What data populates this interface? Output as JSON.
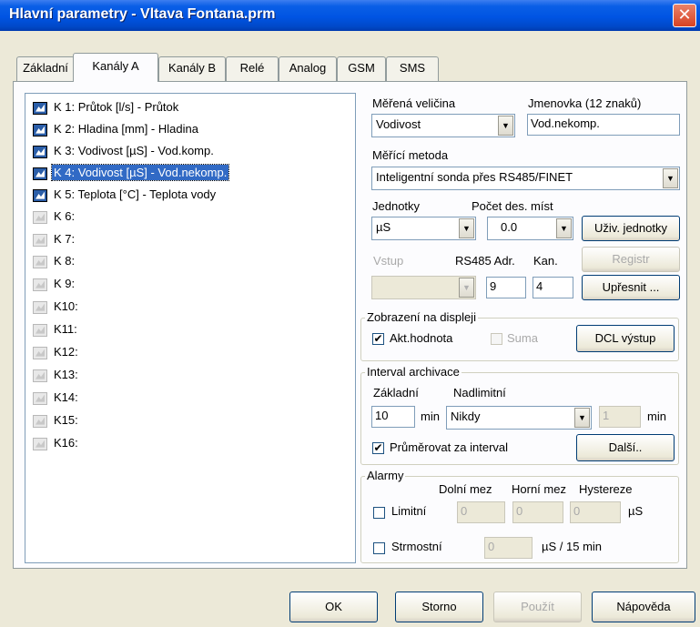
{
  "window": {
    "title": "Hlavní parametry - Vltava Fontana.prm",
    "close_glyph": "✕"
  },
  "tabs": [
    {
      "label": "Základní"
    },
    {
      "label": "Kanály A"
    },
    {
      "label": "Kanály B"
    },
    {
      "label": "Relé"
    },
    {
      "label": "Analog"
    },
    {
      "label": "GSM"
    },
    {
      "label": "SMS"
    }
  ],
  "channels": [
    {
      "label": "K 1: Průtok [l/s] - Průtok"
    },
    {
      "label": "K 2: Hladina [mm] - Hladina"
    },
    {
      "label": "K 3: Vodivost [µS] - Vod.komp."
    },
    {
      "label": "K 4: Vodivost [µS] - Vod.nekomp."
    },
    {
      "label": "K 5: Teplota [°C] - Teplota vody"
    },
    {
      "label": "K 6:"
    },
    {
      "label": "K 7:"
    },
    {
      "label": "K 8:"
    },
    {
      "label": "K 9:"
    },
    {
      "label": "K10:"
    },
    {
      "label": "K11:"
    },
    {
      "label": "K12:"
    },
    {
      "label": "K13:"
    },
    {
      "label": "K14:"
    },
    {
      "label": "K15:"
    },
    {
      "label": "K16:"
    }
  ],
  "measured": {
    "label": "Měřená veličina",
    "value": "Vodivost"
  },
  "nameplate": {
    "label": "Jmenovka  (12 znaků)",
    "value": "Vod.nekomp."
  },
  "method": {
    "label": "Měřící metoda",
    "value": "Inteligentní sonda přes RS485/FINET"
  },
  "units": {
    "label": "Jednotky",
    "value": "µS"
  },
  "decimals": {
    "label": "Počet des. míst",
    "value": "0.0"
  },
  "user_units_button": "Uživ. jednotky",
  "register_button": "Registr",
  "input": {
    "label": "Vstup",
    "value": ""
  },
  "rs485": {
    "adr_label": "RS485 Adr.",
    "kan_label": "Kan.",
    "adr_value": "9",
    "kan_value": "4"
  },
  "refine_button": "Upřesnit ...",
  "display_group": {
    "title": "Zobrazení na displeji",
    "act_value": {
      "label": "Akt.hodnota",
      "checked": true
    },
    "sum": {
      "label": "Suma",
      "checked": false
    },
    "dcl_button": "DCL výstup"
  },
  "archive_group": {
    "title": "Interval archivace",
    "basic_label": "Základní",
    "over_label": "Nadlimitní",
    "basic_value": "10",
    "min_unit": "min",
    "over_value": "Nikdy",
    "over_min_value": "1",
    "over_min_unit": "min",
    "average": {
      "label": "Průměrovat za interval",
      "checked": true
    },
    "more_button": "Další.."
  },
  "alarms_group": {
    "title": "Alarmy",
    "lower_label": "Dolní mez",
    "upper_label": "Horní mez",
    "hyst_label": "Hystereze",
    "limit": {
      "label": "Limitní",
      "checked": false,
      "lower": "0",
      "upper": "0",
      "hyst": "0",
      "unit": "µS"
    },
    "slope": {
      "label": "Strmostní",
      "checked": false,
      "value": "0",
      "unit": "µS / 15 min"
    }
  },
  "footer": {
    "ok": "OK",
    "cancel": "Storno",
    "apply": "Použít",
    "help": "Nápověda"
  },
  "colors": {
    "title_bar": "#0054e3",
    "selection": "#316ac5",
    "dialog_bg": "#ece9d8",
    "close_button": "#d84222"
  }
}
